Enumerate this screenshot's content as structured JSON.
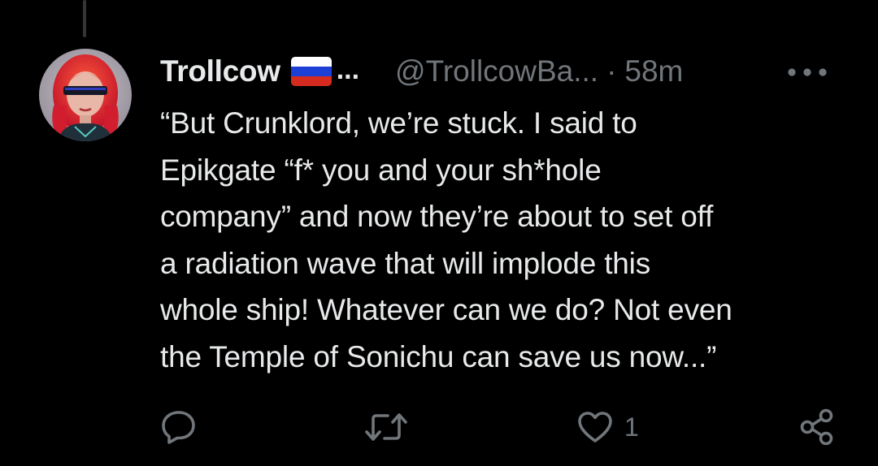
{
  "tweet": {
    "display_name": "Trollcow",
    "name_truncation": "...",
    "handle": "@TrollcowBa...",
    "separator": "·",
    "timestamp": "58m",
    "text": "“But Crunklord, we’re stuck. I said to\nEpikgate “f* you and your sh*hole\ncompany” and now they’re about to set off\na radiation wave that will implode this\nwhole ship! Whatever can we do? Not even\nthe Temple of Sonichu can save us now...”"
  },
  "flag": {
    "stripes": [
      "#ffffff",
      "#1c3fd6",
      "#d52b1e"
    ]
  },
  "actions": {
    "reply_icon": "reply-icon",
    "retweet_icon": "retweet-icon",
    "like_icon": "heart-icon",
    "like_count": "1",
    "share_icon": "share-icon"
  },
  "colors": {
    "background": "#000000",
    "primary_text": "#e7e9ea",
    "secondary_text": "#71767b"
  }
}
